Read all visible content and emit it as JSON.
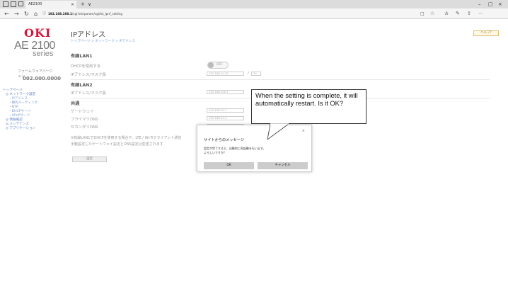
{
  "browser": {
    "tab_title": "AE2100",
    "tab_close": "×",
    "new_tab": "+",
    "tab_menu": "∨",
    "url_host": "192.168.100.1",
    "url_path": "/cgi-bin/param/cgi/lst_lpnf_setting",
    "nav_back": "←",
    "nav_forward": "→",
    "nav_refresh": "↻",
    "nav_home": "⌂",
    "win_min": "–",
    "win_max": "□",
    "win_close": "×"
  },
  "sidebar": {
    "logo": "OKI",
    "model": "AE 2100",
    "series": "series",
    "firmware_label": "ファームウェアバージョン",
    "firmware_version": "002.000.0000",
    "nav": [
      "トップページ",
      "◎ ネットワーク設定",
      "・IPアドレス",
      "・静的ルーティング",
      "・NTP",
      "・DHCPサーバ",
      "・UPnPサーバ",
      "◎ 情報確認",
      "◎ メンテナンス",
      "◎ アプリケーション"
    ]
  },
  "main": {
    "title": "IPアドレス",
    "breadcrumb": "トップページ > ネットワーク > IPアドレス",
    "help": "ヘルプ?",
    "lan1": {
      "title": "有線LAN1",
      "dhcp_label": "DHCPを使用する",
      "dhcp_state": "OFF",
      "ip_label": "IPアドレス/マスク長",
      "ip_value": "192.168.20.20",
      "mask_value": "24",
      "slash": "/"
    },
    "lan2": {
      "title": "有線LAN2",
      "ip_label": "IPアドレス/マスク長",
      "ip_value": "192.168.100.1"
    },
    "common": {
      "title": "共通",
      "gateway_label": "ゲートウェイ",
      "gateway_value": "192.168.20.1",
      "dns1_label": "プライマリDNS",
      "dns1_value": "192.168.43.1",
      "dns2_label": "セカンダリDNS"
    },
    "note1": "※有線LAN1でDHCPを使用する場合や、LTE / Wi-Fiクライアント通信",
    "note2": "手動設定したゲートウェイ設定とDNS設定は変更されます",
    "set_button": "設定"
  },
  "dialog": {
    "close": "×",
    "title": "サイトからのメッセージ",
    "message_line1": "設定が完了すると、自動的に再起動を行います。",
    "message_line2": "よろしいですか？",
    "ok": "OK",
    "cancel": "キャンセル"
  },
  "callout": {
    "text": "When the setting is complete, it will automatically restart. Is it OK?"
  },
  "colors": {
    "logo": "#d6173a",
    "nav_link": "#5a7fc4",
    "chrome": "#dcdcdc"
  }
}
